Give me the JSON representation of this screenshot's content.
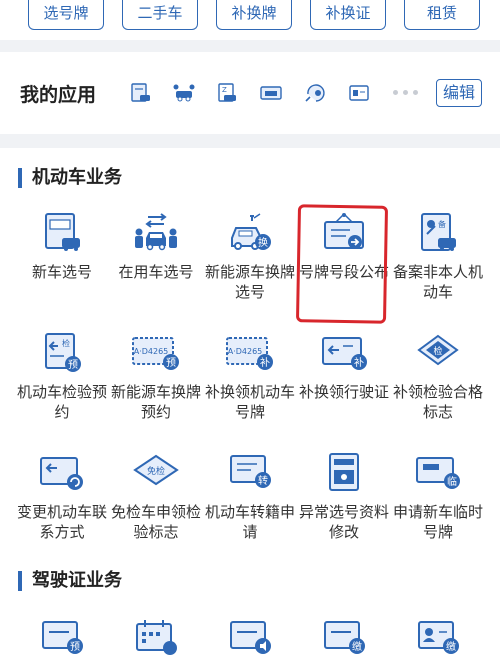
{
  "top_buttons": [
    "选号牌",
    "二手车",
    "补换牌",
    "补换证",
    "租赁"
  ],
  "apps": {
    "title": "我的应用",
    "icons": [
      "new-car-plate-icon",
      "used-car-plate-icon",
      "ev-plate-icon",
      "plate-pool-icon",
      "reissue-icon",
      "license-card-icon"
    ],
    "edit_label": "编辑"
  },
  "sections": [
    {
      "title": "机动车业务",
      "items": [
        {
          "label": "新车选号",
          "icon": "plate-car-icon"
        },
        {
          "label": "在用车选号",
          "icon": "car-people-icon"
        },
        {
          "label": "新能源车换牌选号",
          "icon": "ev-exchange-icon"
        },
        {
          "label": "号牌号段公布",
          "icon": "plate-sign-icon"
        },
        {
          "label": "备案非本人机动车",
          "icon": "record-doc-icon"
        },
        {
          "label": "机动车检验预约",
          "icon": "inspection-booking-icon"
        },
        {
          "label": "新能源车换牌预约",
          "icon": "ev-plate-booking-icon"
        },
        {
          "label": "补换领机动车号牌",
          "icon": "plate-reissue-icon"
        },
        {
          "label": "补换领行驶证",
          "icon": "license-reissue-icon"
        },
        {
          "label": "补领检验合格标志",
          "icon": "inspection-mark-icon"
        },
        {
          "label": "变更机动车联系方式",
          "icon": "contact-change-icon"
        },
        {
          "label": "免检车申领检验标志",
          "icon": "exempt-mark-icon"
        },
        {
          "label": "机动车转籍申请",
          "icon": "transfer-icon"
        },
        {
          "label": "异常选号资料修改",
          "icon": "abnormal-edit-icon"
        },
        {
          "label": "申请新车临时号牌",
          "icon": "temp-plate-icon"
        }
      ]
    },
    {
      "title": "驾驶证业务",
      "items": [
        {
          "label": "",
          "icon": "license-booking-icon"
        },
        {
          "label": "",
          "icon": "calendar-icon"
        },
        {
          "label": "",
          "icon": "license-notify-icon"
        },
        {
          "label": "",
          "icon": "license-pay-icon"
        },
        {
          "label": "",
          "icon": "id-pay-icon"
        }
      ]
    }
  ],
  "badges": {
    "exchange": "换",
    "booking": "预",
    "reissue": "补",
    "inspect": "检",
    "exempt": "免检",
    "transfer": "转",
    "temp": "临",
    "pay": "缴",
    "record": "备"
  },
  "plate_text": "A·D4265",
  "colors": {
    "primary": "#2f68b5",
    "light": "#e6eefb",
    "highlight": "#d8262c"
  }
}
